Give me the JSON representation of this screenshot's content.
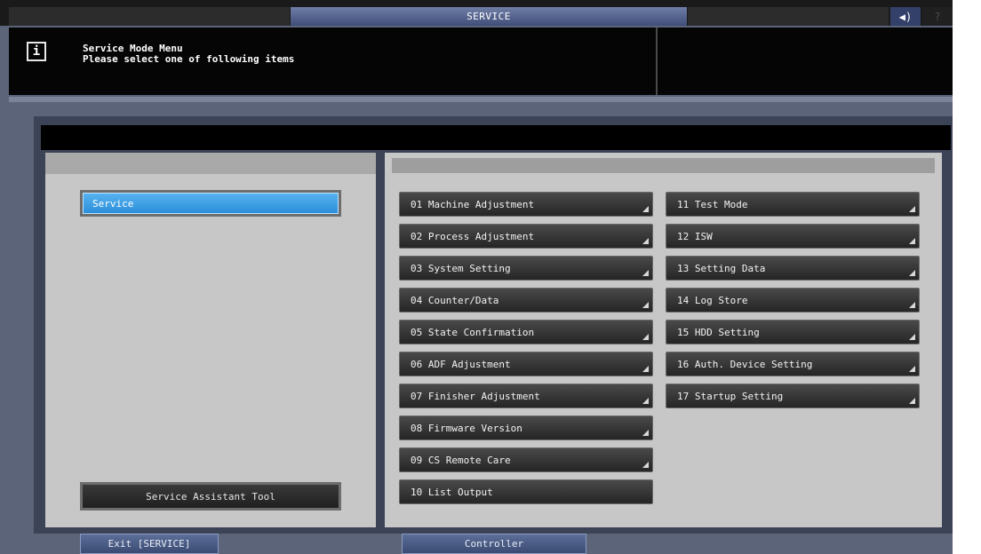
{
  "topbar": {
    "title": "SERVICE",
    "speaker_glyph": "◀)",
    "help_glyph": "?",
    "accent_color": "#4a5a86"
  },
  "message": {
    "info_glyph": "i",
    "title": "Service Mode Menu",
    "subtitle": "Please select one of following items"
  },
  "left_panel": {
    "selected_item": "Service",
    "assistant_button": "Service Assistant Tool"
  },
  "menu": {
    "items": [
      {
        "label": "01 Machine Adjustment"
      },
      {
        "label": "02 Process Adjustment"
      },
      {
        "label": "03 System Setting"
      },
      {
        "label": "04 Counter/Data"
      },
      {
        "label": "05 State Confirmation"
      },
      {
        "label": "06 ADF Adjustment"
      },
      {
        "label": "07 Finisher Adjustment"
      },
      {
        "label": "08 Firmware Version"
      },
      {
        "label": "09 CS Remote Care"
      },
      {
        "label": "10 List Output"
      },
      {
        "label": "11 Test Mode"
      },
      {
        "label": "12 ISW"
      },
      {
        "label": "13 Setting Data"
      },
      {
        "label": "14 Log Store"
      },
      {
        "label": "15 HDD Setting"
      },
      {
        "label": "16 Auth. Device Setting"
      },
      {
        "label": "17 Startup Setting"
      }
    ]
  },
  "bottom": {
    "exit_label": "Exit [SERVICE]",
    "controller_label": "Controller"
  }
}
